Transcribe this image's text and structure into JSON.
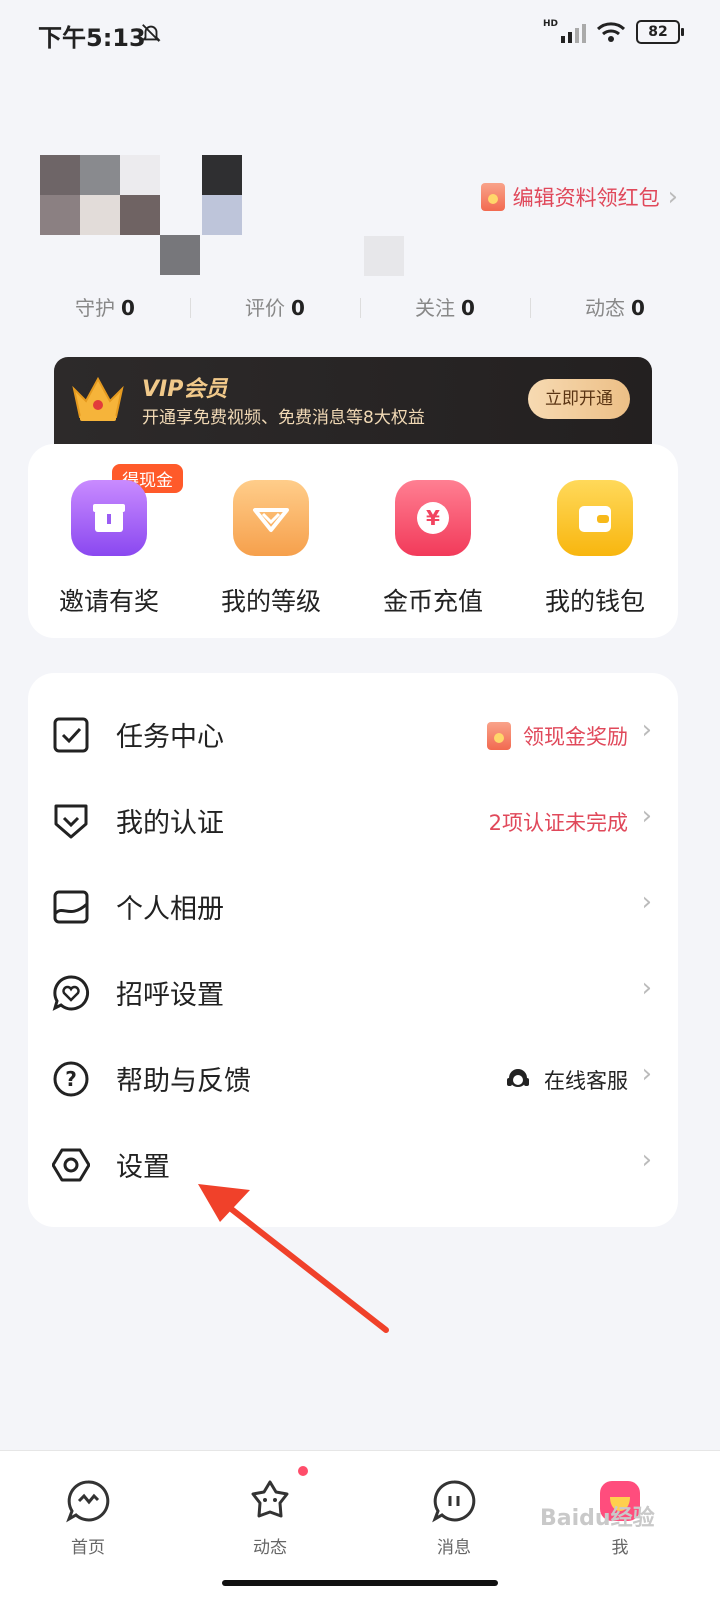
{
  "status_bar": {
    "time": "下午5:13",
    "network": "HD",
    "battery": "82"
  },
  "profile": {
    "edit_promo": "编辑资料领红包"
  },
  "stats": [
    {
      "label": "守护",
      "value": "0"
    },
    {
      "label": "评价",
      "value": "0"
    },
    {
      "label": "关注",
      "value": "0"
    },
    {
      "label": "动态",
      "value": "0"
    }
  ],
  "vip": {
    "title": "VIP会员",
    "subtitle": "开通享免费视频、免费消息等8大权益",
    "button": "立即开通"
  },
  "quick_actions": {
    "badge": "得现金",
    "items": [
      {
        "label": "邀请有奖",
        "icon": "gift-icon"
      },
      {
        "label": "我的等级",
        "icon": "level-diamond-icon"
      },
      {
        "label": "金币充值",
        "icon": "coin-recharge-icon"
      },
      {
        "label": "我的钱包",
        "icon": "wallet-icon"
      }
    ]
  },
  "menu": [
    {
      "label": "任务中心",
      "right": "领现金奖励",
      "icon": "task-checkbox-icon"
    },
    {
      "label": "我的认证",
      "right": "2项认证未完成",
      "icon": "verify-shield-icon"
    },
    {
      "label": "个人相册",
      "right": "",
      "icon": "album-icon"
    },
    {
      "label": "招呼设置",
      "right": "",
      "icon": "greeting-heart-icon"
    },
    {
      "label": "帮助与反馈",
      "right": "在线客服",
      "icon": "help-question-icon"
    },
    {
      "label": "设置",
      "right": "",
      "icon": "settings-hexagon-icon"
    }
  ],
  "colors": {
    "accent_red": "#e0485a",
    "vip_gold": "#f1c98a",
    "page_bg": "#f4f5f9"
  },
  "bottom_nav": [
    {
      "label": "首页",
      "icon": "home-heart-bubble-icon"
    },
    {
      "label": "动态",
      "icon": "moments-star-icon"
    },
    {
      "label": "消息",
      "icon": "message-bubble-icon"
    },
    {
      "label": "我",
      "icon": "profile-icon"
    }
  ],
  "watermark": "Baidu经验"
}
